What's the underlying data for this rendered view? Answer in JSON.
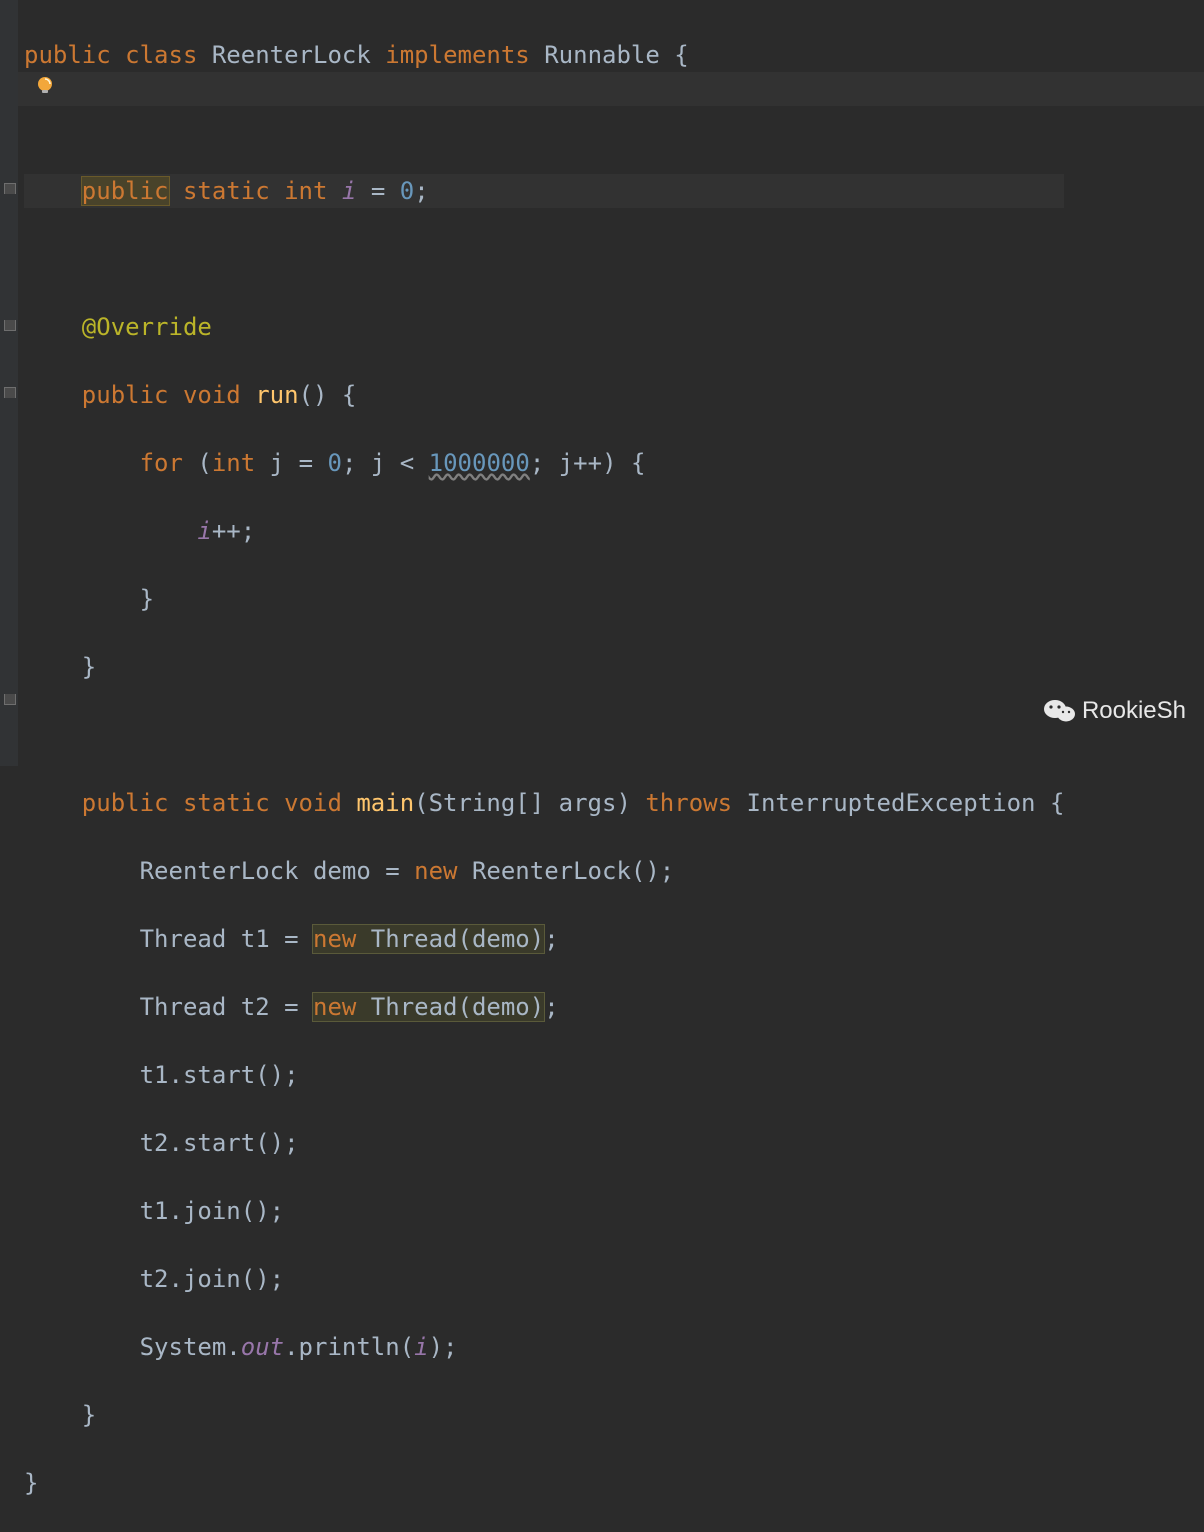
{
  "code": {
    "kw_public": "public",
    "kw_class": "class",
    "cls_name": "ReenterLock",
    "kw_implements": "implements",
    "iface": "Runnable",
    "brace_open": "{",
    "brace_close": "}",
    "kw_static": "static",
    "kw_int": "int",
    "field_i": "i",
    "eq": "=",
    "zero": "0",
    "semi": ";",
    "override": "@Override",
    "kw_void": "void",
    "fn_run": "run",
    "parens": "()",
    "kw_for": "for",
    "paren_open": "(",
    "paren_close": ")",
    "var_j": "j",
    "lt": "<",
    "million": "1000000",
    "jpp": "j++",
    "ipp": "++",
    "fn_main": "main",
    "main_args": "(String[] args)",
    "kw_throws": "throws",
    "exc": "InterruptedException",
    "demo_decl": "ReenterLock demo ",
    "kw_new": "new",
    "ctor_call": " ReenterLock();",
    "t1_decl": "Thread t1 ",
    "t2_decl": "Thread t2 ",
    "thread_call": " Thread(demo)",
    "t1_start": "t1.start();",
    "t2_start": "t2.start();",
    "t1_join": "t1.join();",
    "t2_join": "t2.join();",
    "sys": "System.",
    "out": "out",
    "println_open": ".println(",
    "println_close": ");"
  },
  "watermark": {
    "text": "RookieSh"
  }
}
